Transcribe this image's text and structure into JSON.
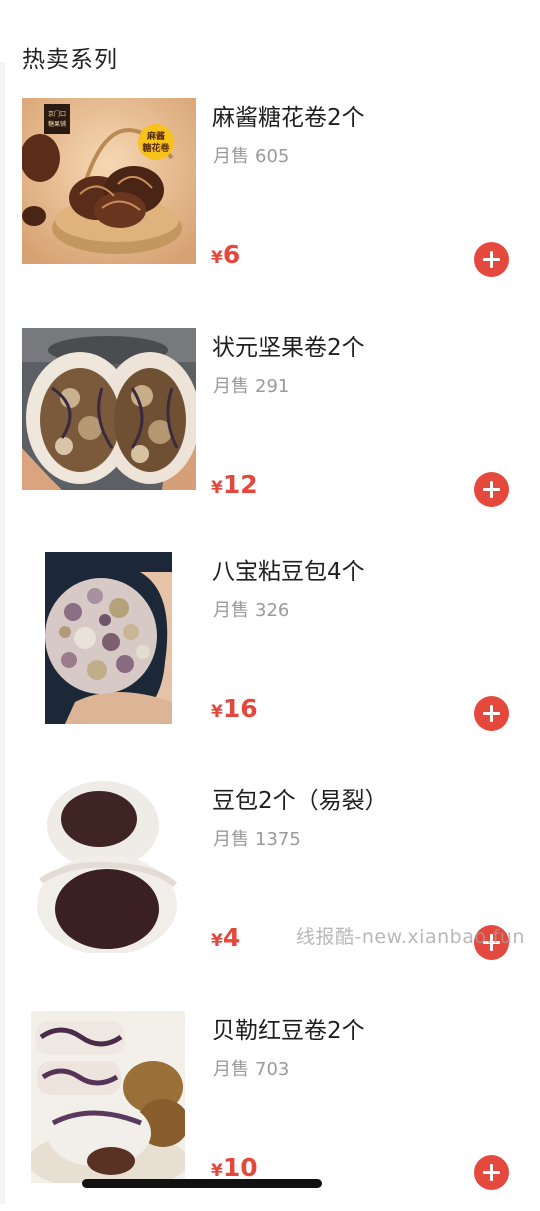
{
  "section": {
    "title": "热卖系列"
  },
  "sales_label": "月售",
  "currency": "¥",
  "products": [
    {
      "name": "麻酱糖花卷2个",
      "sales": "605",
      "price": "6",
      "badge": "麻酱\n糖花卷",
      "shop_label": "京门口\n糖果铺"
    },
    {
      "name": "状元坚果卷2个",
      "sales": "291",
      "price": "12"
    },
    {
      "name": "八宝粘豆包4个",
      "sales": "326",
      "price": "16"
    },
    {
      "name": "豆包2个（易裂）",
      "sales": "1375",
      "price": "4"
    },
    {
      "name": "贝勒红豆卷2个",
      "sales": "703",
      "price": "10"
    }
  ],
  "watermark": "线报酷-new.xianbao.fun",
  "colors": {
    "accent": "#e5493d",
    "price": "#e4483c",
    "muted": "#9a9a9a"
  },
  "icons": {
    "add": "plus-circle-icon"
  }
}
